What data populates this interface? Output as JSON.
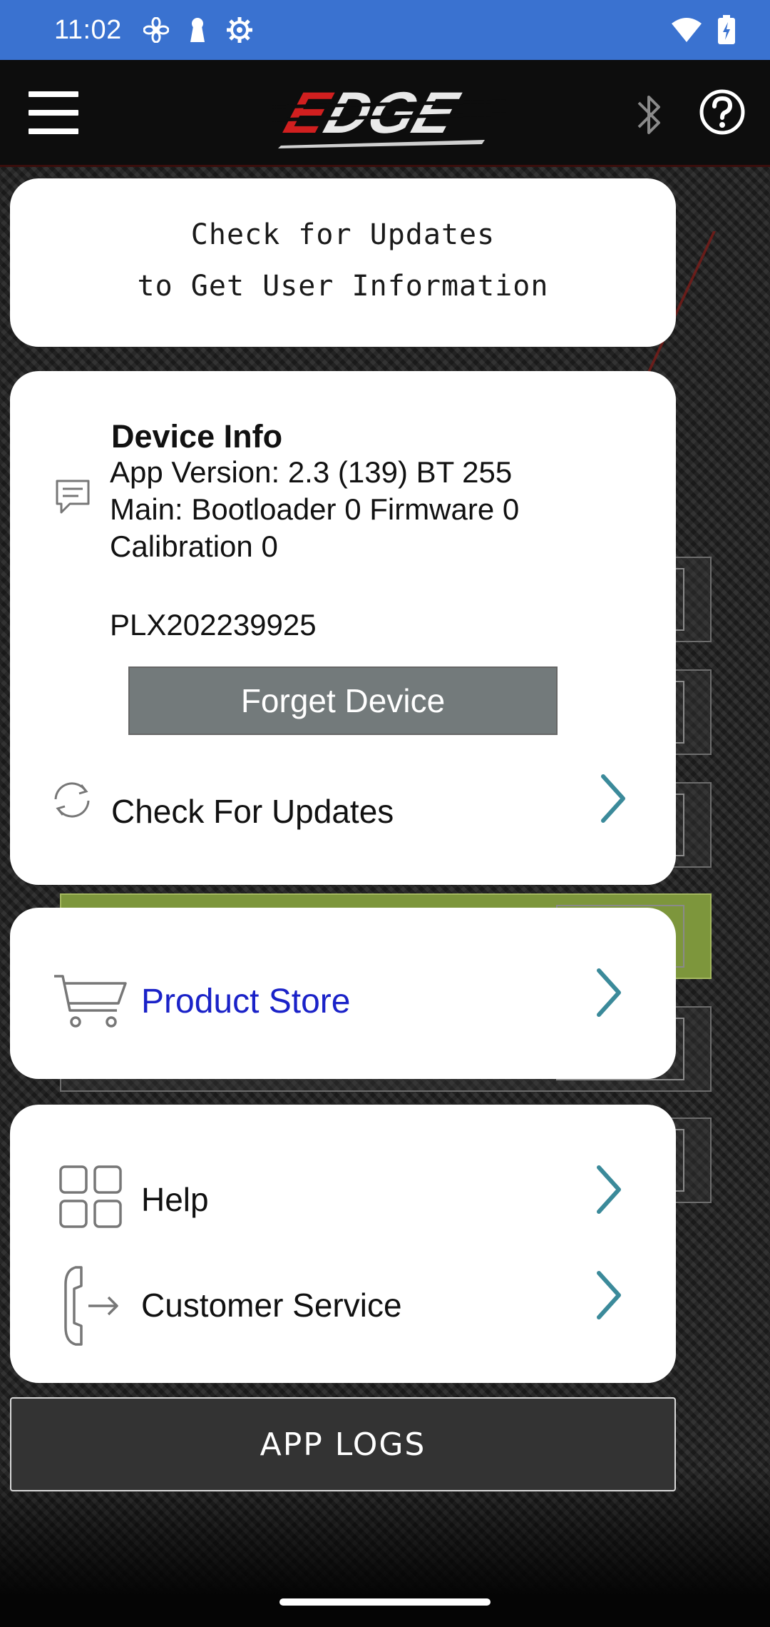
{
  "status_bar": {
    "time": "11:02",
    "icons": [
      "fan-icon",
      "keyhole-icon",
      "settings-gear-icon"
    ],
    "right_icons": [
      "wifi-icon",
      "battery-charging-icon"
    ]
  },
  "header": {
    "logo_text": "EDGE",
    "menu_icon": "hamburger-icon",
    "bluetooth_icon": "bluetooth-icon",
    "help_icon": "help-circle-icon"
  },
  "updates_banner": {
    "line1": "Check for Updates",
    "line2": "to Get User Information"
  },
  "device_info": {
    "title": "Device Info",
    "app_version": "App Version: 2.3 (139) BT 255",
    "main": "Main: Bootloader 0 Firmware 0",
    "calibration": "Calibration 0",
    "serial": "PLX202239925",
    "forget_button": "Forget Device",
    "check_updates": "Check For Updates"
  },
  "store": {
    "label": "Product Store"
  },
  "support": {
    "help": "Help",
    "customer_service": "Customer Service"
  },
  "footer": {
    "app_logs": "APP LOGS"
  },
  "colors": {
    "status_bar": "#3a72d0",
    "store_link": "#1a22c8",
    "chevron": "#3b8a9a",
    "forget_button": "#737a7b"
  }
}
